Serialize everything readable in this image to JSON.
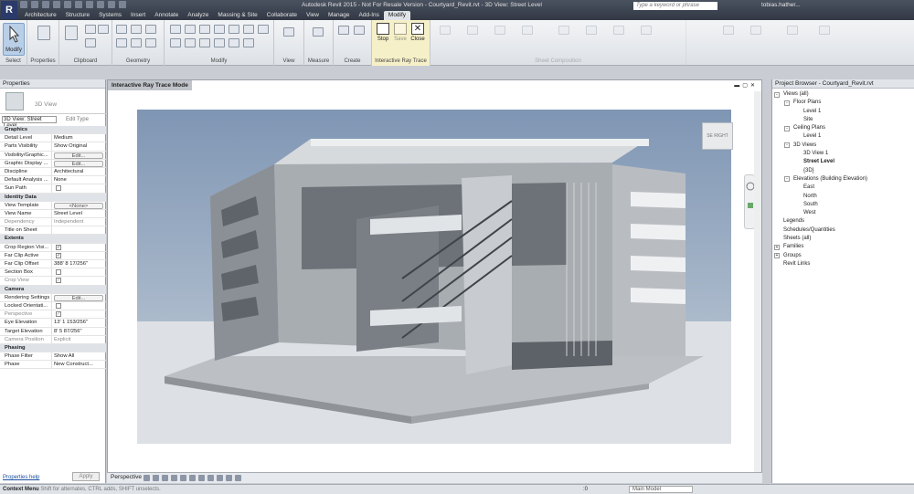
{
  "app": {
    "logo": "R",
    "title": "Autodesk Revit 2015 - Not For Resale Version - Courtyard_Revit.rvt - 3D View: Street Level"
  },
  "search": {
    "placeholder": "Type a keyword or phrase"
  },
  "user": {
    "name": "tobias.hather..."
  },
  "tabs": [
    "Architecture",
    "Structure",
    "Systems",
    "Insert",
    "Annotate",
    "Analyze",
    "Massing & Site",
    "Collaborate",
    "View",
    "Manage",
    "Add-Ins",
    "Modify"
  ],
  "ribbon": {
    "modify_label": "Modify",
    "panels": [
      "Select",
      "Properties",
      "Clipboard",
      "Geometry",
      "Modify",
      "View",
      "Measure",
      "Create",
      "Interactive Ray Trace",
      "Sheet Composition"
    ],
    "irt_buttons": [
      "Stop",
      "Save",
      "Close"
    ]
  },
  "properties": {
    "header": "Properties",
    "type_name": "3D View",
    "instance": "3D View: Street Level",
    "edit_type": "Edit Type",
    "help": "Properties help",
    "apply": "Apply",
    "rows": [
      {
        "section": "Graphics"
      },
      {
        "k": "Detail Level",
        "v": "Medium"
      },
      {
        "k": "Parts Visibility",
        "v": "Show Original"
      },
      {
        "k": "Visibility/Graphic...",
        "btn": "Edit..."
      },
      {
        "k": "Graphic Display ...",
        "btn": "Edit..."
      },
      {
        "k": "Discipline",
        "v": "Architectural"
      },
      {
        "k": "Default Analysis ...",
        "v": "None"
      },
      {
        "k": "Sun Path",
        "cb": false
      },
      {
        "section": "Identity Data"
      },
      {
        "k": "View Template",
        "btn": "<None>"
      },
      {
        "k": "View Name",
        "v": "Street Level"
      },
      {
        "k": "Dependency",
        "v": "Independent",
        "gray": true
      },
      {
        "k": "Title on Sheet",
        "v": ""
      },
      {
        "section": "Extents"
      },
      {
        "k": "Crop Region Visi...",
        "cb": true
      },
      {
        "k": "Far Clip Active",
        "cb": true
      },
      {
        "k": "Far Clip Offset",
        "v": "388' 8 17/256\""
      },
      {
        "k": "Section Box",
        "cb": false
      },
      {
        "k": "Crop View",
        "cb": true,
        "gray": true
      },
      {
        "section": "Camera"
      },
      {
        "k": "Rendering Settings",
        "btn": "Edit..."
      },
      {
        "k": "Locked Orientati...",
        "cb": false
      },
      {
        "k": "Perspective",
        "cb": true,
        "gray": true
      },
      {
        "k": "Eye Elevation",
        "v": "13' 1 153/256\""
      },
      {
        "k": "Target Elevation",
        "v": "8' 5 87/256\""
      },
      {
        "k": "Camera Position",
        "v": "Explicit",
        "gray": true
      },
      {
        "section": "Phasing"
      },
      {
        "k": "Phase Filter",
        "v": "Show All"
      },
      {
        "k": "Phase",
        "v": "New Construct..."
      }
    ]
  },
  "view": {
    "title": "Interactive Ray Trace Mode",
    "viewcube": "SE RIGHT",
    "scale_label": "Perspective"
  },
  "project_browser": {
    "header": "Project Browser - Courtyard_Revit.rvt",
    "items": [
      {
        "label": "Views (all)",
        "d": 0,
        "t": "-"
      },
      {
        "label": "Floor Plans",
        "d": 1,
        "t": "-"
      },
      {
        "label": "Level 1",
        "d": 2
      },
      {
        "label": "Site",
        "d": 2
      },
      {
        "label": "Ceiling Plans",
        "d": 1,
        "t": "-"
      },
      {
        "label": "Level 1",
        "d": 2
      },
      {
        "label": "3D Views",
        "d": 1,
        "t": "-"
      },
      {
        "label": "3D View 1",
        "d": 2
      },
      {
        "label": "Street Level",
        "d": 2,
        "sel": true
      },
      {
        "label": "{3D}",
        "d": 2
      },
      {
        "label": "Elevations (Building Elevation)",
        "d": 1,
        "t": "-"
      },
      {
        "label": "East",
        "d": 2
      },
      {
        "label": "North",
        "d": 2
      },
      {
        "label": "South",
        "d": 2
      },
      {
        "label": "West",
        "d": 2
      },
      {
        "label": "Legends",
        "d": 0
      },
      {
        "label": "Schedules/Quantities",
        "d": 0
      },
      {
        "label": "Sheets (all)",
        "d": 0
      },
      {
        "label": "Families",
        "d": 0,
        "t": "+"
      },
      {
        "label": "Groups",
        "d": 0,
        "t": "+"
      },
      {
        "label": "Revit Links",
        "d": 0
      }
    ]
  },
  "status": {
    "mode": "Context Menu",
    "hint": "Shift for alternates, CTRL adds, SHIFT unselects.",
    "zero": ":0",
    "model": "Main Model"
  },
  "colors": {
    "sky": "#8fa3bd",
    "ground": "#dfe3e7",
    "accent": "#b9cfe8"
  }
}
